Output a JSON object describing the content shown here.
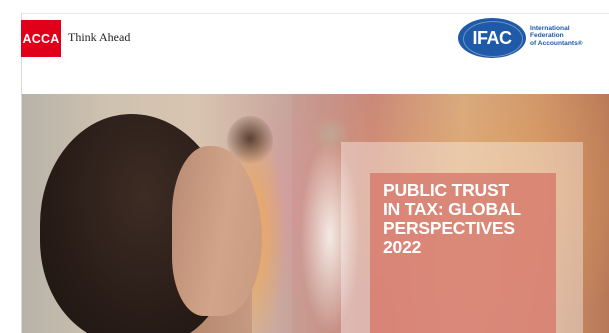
{
  "header": {
    "acca_logo_text": "ACCA",
    "tagline": "Think Ahead",
    "ifac_logo_text": "IFAC",
    "ifac_name_lines": [
      "International",
      "Federation",
      "of Accountants®"
    ]
  },
  "cover": {
    "title_lines": [
      "PUBLIC TRUST",
      "IN TAX: GLOBAL",
      "PERSPECTIVES",
      "2022"
    ]
  },
  "colors": {
    "acca_red": "#e1001a",
    "ifac_blue": "#1e5aa8",
    "title_box": "#d77a6c"
  }
}
